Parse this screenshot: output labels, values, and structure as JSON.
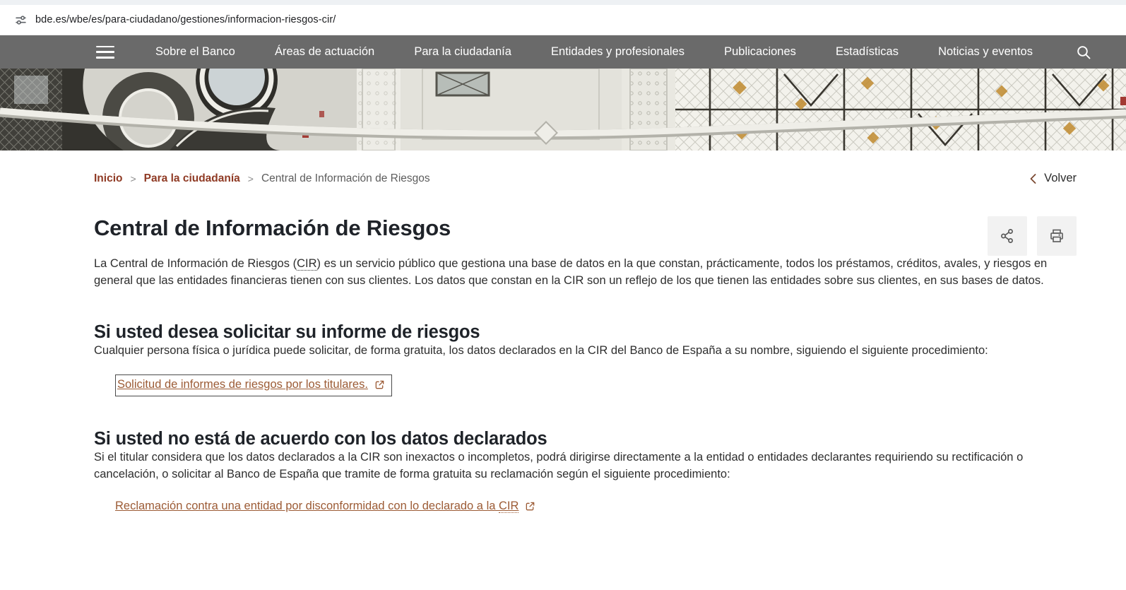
{
  "browser": {
    "url": "bde.es/wbe/es/para-ciudadano/gestiones/informacion-riesgos-cir/",
    "site_info_icon": "site-settings-icon"
  },
  "nav": {
    "menu_icon": "hamburger-icon",
    "search_icon": "search-icon",
    "items": [
      "Sobre el Banco",
      "Áreas de actuación",
      "Para la ciudadanía",
      "Entidades y profesionales",
      "Publicaciones",
      "Estadísticas",
      "Noticias y eventos"
    ]
  },
  "hero_image": "banco-de-espana-stained-glass-ceiling",
  "breadcrumb": {
    "separator": ">",
    "items": [
      {
        "label": "Inicio"
      },
      {
        "label": "Para la ciudadanía"
      },
      {
        "label": "Central de Información de Riesgos"
      }
    ]
  },
  "back": {
    "label": "Volver",
    "icon": "chevron-left-icon"
  },
  "toolbar": {
    "share_icon": "share-icon",
    "print_icon": "print-icon"
  },
  "page": {
    "title": "Central de Información de Riesgos",
    "intro": {
      "part1": "La Central de Información de Riesgos (",
      "abbr": "CIR",
      "part2": ") es un servicio público que gestiona una base de datos en la que constan, prácticamente, todos los préstamos, créditos, avales, y riesgos en general que las entidades financieras tienen con sus clientes. Los datos que constan en la CIR son un reflejo de los que tienen las entidades sobre sus clientes, en sus bases de datos."
    },
    "sections": [
      {
        "heading": "Si usted desea solicitar su informe de riesgos",
        "body": "Cualquier persona física o jurídica puede solicitar, de forma gratuita, los datos declarados en la CIR del Banco de España a su nombre, siguiendo el siguiente procedimiento:",
        "link": {
          "label": "Solicitud de informes de riesgos por los titulares.",
          "icon": "external-link-icon"
        }
      },
      {
        "heading": "Si usted no está de acuerdo con los datos declarados",
        "body": "Si el titular considera que los datos declarados a la CIR son inexactos o incompletos, podrá dirigirse directamente a la entidad o entidades declarantes requiriendo su rectificación o cancelación, o solicitar al Banco de España que tramite de forma gratuita su reclamación según el siguiente procedimiento:",
        "link": {
          "label_pre": "Reclamación contra una entidad por disconformidad con lo declarado a la ",
          "label_abbr": "CIR",
          "icon": "external-link-icon"
        }
      }
    ]
  },
  "colors": {
    "nav_bg": "#6a6a6a",
    "breadcrumb_link": "#8f3a24",
    "doc_link": "#9c5b35",
    "heading_text": "#1f2329",
    "icon_button_bg": "#f2f2f2",
    "hero_amber": "#c08a2e"
  }
}
